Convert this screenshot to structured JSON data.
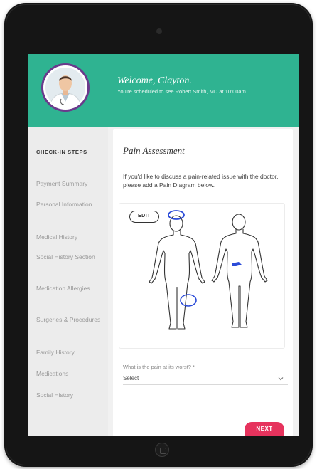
{
  "header": {
    "welcome": "Welcome, Clayton.",
    "scheduled": "You're scheduled to see Robert Smith, MD at 10:00am."
  },
  "sidebar": {
    "title": "CHECK-IN STEPS",
    "steps": [
      "Payment Summary",
      "Personal Information",
      "Medical History",
      "Social History Section",
      "Medication Allergies",
      "Surgeries & Procedures",
      "Family History",
      "Medications",
      "Social History"
    ]
  },
  "main": {
    "title": "Pain Assessment",
    "description": "If you'd like to discuss a pain-related issue with the doctor, please add a Pain Diagram below.",
    "edit_label": "EDIT",
    "question": "What is the pain at its worst? *",
    "select_value": "Select",
    "next_label": "NEXT"
  },
  "colors": {
    "header_green": "#2fb391",
    "next_pink": "#e6335d",
    "avatar_ring": "#6a3a8c",
    "mark_blue": "#2b4bd8"
  },
  "icons": [
    "doctor-avatar",
    "chevron-down-icon",
    "camera-icon",
    "home-button-icon"
  ]
}
